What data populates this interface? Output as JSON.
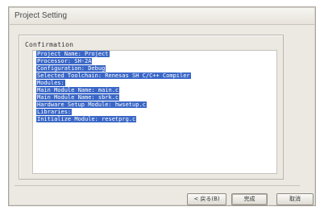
{
  "window": {
    "title": "Project Setting"
  },
  "confirmation": {
    "label": "Confirmation",
    "lines": [
      "Project Name: Project",
      "Processor: SH-2A",
      "Configuration: Debug",
      "Selected Toolchain: Renesas SH C/C++ Compiler",
      "Modules:",
      "Main Module Name: main.c",
      "Main Module Name: sbrk.c",
      "Hardware Setup Module: hwsetup.c",
      "Libraries:",
      "Initialize Module: resetprg.c"
    ]
  },
  "buttons": {
    "back": "< 戻る(B)",
    "finish": "完成",
    "cancel": "取消"
  }
}
